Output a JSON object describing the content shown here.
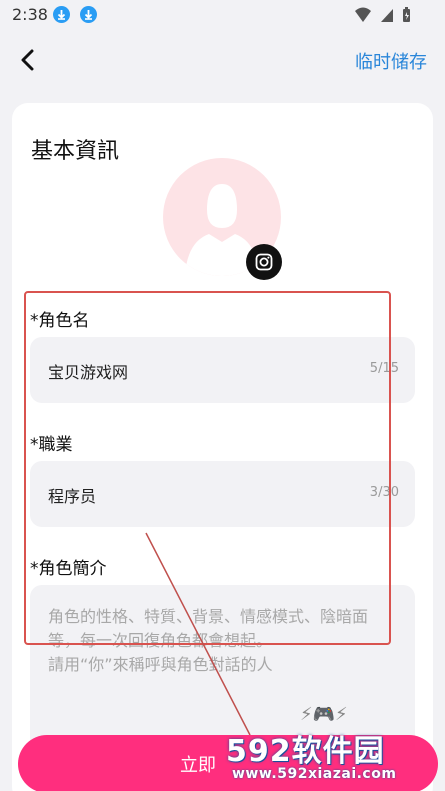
{
  "status_bar": {
    "time": "2:38"
  },
  "app_bar": {
    "save_draft_label": "临时储存"
  },
  "profile": {
    "section_title": "基本資訊",
    "fields": {
      "name": {
        "label": "*角色名",
        "value": "宝贝游戏网",
        "counter": "5/15"
      },
      "job": {
        "label": "*職業",
        "value": "程序员",
        "counter": "3/30"
      },
      "intro": {
        "label": "*角色簡介",
        "placeholder": "角色的性格、特質、背景、情感模式、陰暗面等，每一次回復角色都會想起。\n請用“你”來稱呼與角色對話的人"
      }
    }
  },
  "submit": {
    "label": "立即"
  },
  "watermark": {
    "brand": "592软件园",
    "url": "www.592xiazai.com"
  },
  "colors": {
    "accent": "#ff2e7e",
    "link": "#2a86d9",
    "highlight": "#d9534f"
  }
}
